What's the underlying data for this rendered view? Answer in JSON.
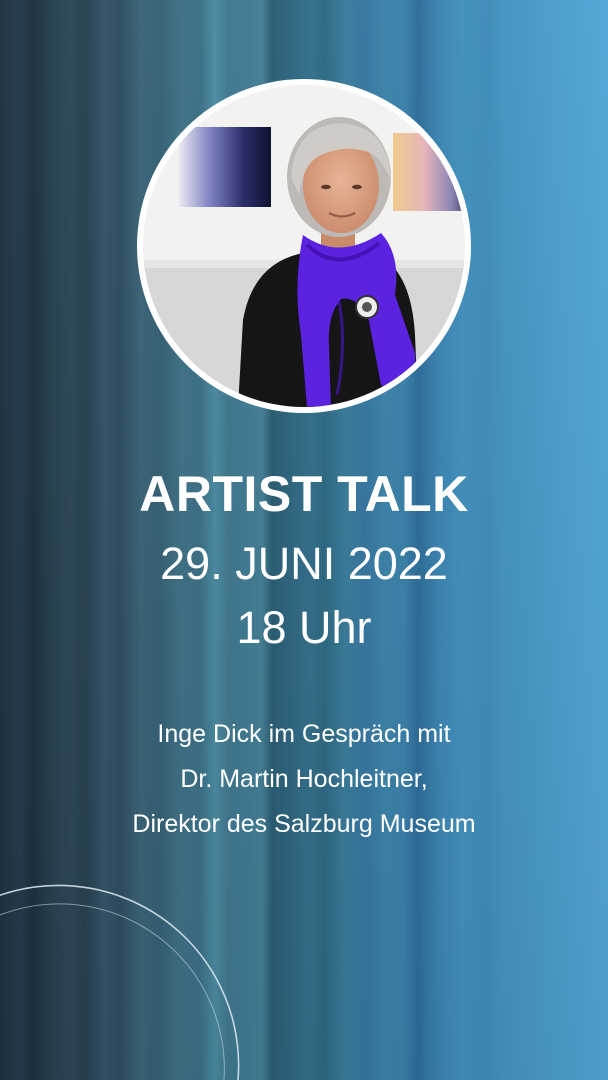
{
  "title": "ARTIST TALK",
  "date": "29. JUNI 2022",
  "time": "18 Uhr",
  "description": {
    "line1": "Inge Dick im Gespräch mit",
    "line2": "Dr. Martin Hochleitner,",
    "line3": "Direktor des Salzburg Museum"
  },
  "colors": {
    "background_left": "#1f3242",
    "background_right": "#52a6d6",
    "text": "#ffffff",
    "scarf": "#5b22e0"
  }
}
